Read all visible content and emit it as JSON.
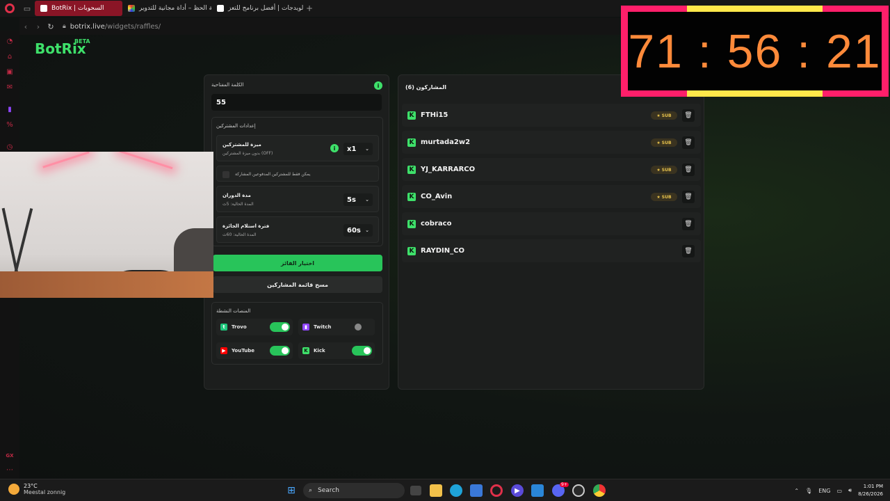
{
  "browser": {
    "tabs": [
      {
        "label": "BotRix | السحوبات",
        "active": true,
        "color": "#8a1526"
      },
      {
        "label": "عجلة الحظ – أداة مجانية للتدوير",
        "active": false
      },
      {
        "label": "الويدجات | أفضل برنامج للتعز...",
        "active": false
      }
    ],
    "url_host": "botrix.live",
    "url_path": "/widgets/raffles/"
  },
  "logo": {
    "name": "BotRix",
    "badge": "BETA"
  },
  "left_panel": {
    "keyword_label": "الكلمة المفتاحية",
    "keyword_value": "55",
    "sub_settings_title": "إعدادات المشتركين",
    "sub_perk": {
      "title": "ميزة للمشتركين",
      "subtitle": "بدون ميزة المشتركين (OFF)",
      "value": "x1"
    },
    "only_subs_label": "يمكن فقط للمشتركين المدفوعين المشاركة",
    "spin_duration": {
      "title": "مدة الدوران",
      "subtitle": "المدة الحالية: 5ث",
      "value": "5s"
    },
    "claim_time": {
      "title": "فترة استلام الجائزة",
      "subtitle": "المدة الحالية: 60ث",
      "value": "60s"
    },
    "pick_winner_label": "اختيار الفائز",
    "clear_list_label": "مسح قائمة المشاركين",
    "platforms_title": "المنصات النشطة",
    "platforms": [
      {
        "name": "Trovo",
        "enabled": true,
        "color": "#1ec77c"
      },
      {
        "name": "Twitch",
        "enabled": false,
        "color": "#9146ff"
      },
      {
        "name": "YouTube",
        "enabled": true,
        "color": "#ff0000"
      },
      {
        "name": "Kick",
        "enabled": true,
        "color": "#3ee06a"
      }
    ]
  },
  "right_panel": {
    "title": "المشاركون (6)",
    "sub_badge": "SUB",
    "participants": [
      {
        "name": "FTHi15",
        "sub": true
      },
      {
        "name": "murtada2w2",
        "sub": true
      },
      {
        "name": "YJ_KARRARCO",
        "sub": true
      },
      {
        "name": "CO_Avin",
        "sub": true
      },
      {
        "name": "cobraco",
        "sub": false
      },
      {
        "name": "RAYDIN_CO",
        "sub": false
      }
    ]
  },
  "timer": {
    "text": "71 : 56 : 21"
  },
  "taskbar": {
    "temp": "23°C",
    "weather": "Meestal zonnig",
    "search_placeholder": "Search",
    "lang": "ENG",
    "time": "1:01 PM",
    "date": "8/26/2026",
    "discord_badge": "9+"
  },
  "sidebar": {
    "gx_label": "GX"
  }
}
